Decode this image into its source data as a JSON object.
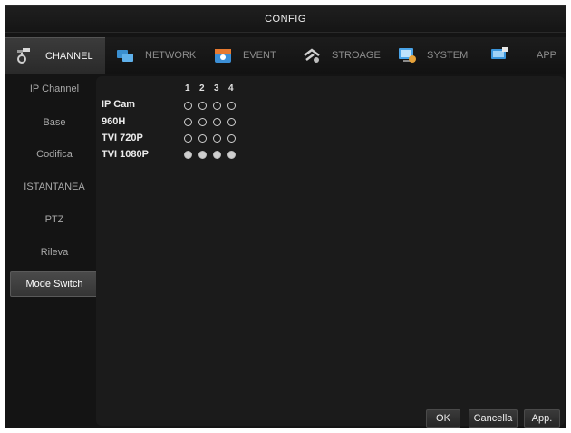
{
  "window": {
    "title": "CONFIG"
  },
  "tabs": [
    {
      "label": "CHANNEL",
      "icon": "channel-icon",
      "active": true
    },
    {
      "label": "NETWORK",
      "icon": "network-icon",
      "active": false
    },
    {
      "label": "EVENT",
      "icon": "event-icon",
      "active": false
    },
    {
      "label": "STROAGE",
      "icon": "storage-icon",
      "active": false
    },
    {
      "label": "SYSTEM",
      "icon": "system-icon",
      "active": false
    },
    {
      "label": "APP",
      "icon": "app-icon",
      "active": false
    }
  ],
  "sidebar": {
    "items": [
      {
        "label": "IP Channel",
        "active": false
      },
      {
        "label": "Base",
        "active": false
      },
      {
        "label": "Codifica",
        "active": false
      },
      {
        "label": "ISTANTANEA",
        "active": false
      },
      {
        "label": "PTZ",
        "active": false
      },
      {
        "label": "Rileva",
        "active": false
      },
      {
        "label": "Mode Switch",
        "active": true
      }
    ]
  },
  "mode_switch": {
    "channels": [
      "1",
      "2",
      "3",
      "4"
    ],
    "modes": [
      {
        "label": "IP Cam",
        "selected": [
          false,
          false,
          false,
          false
        ]
      },
      {
        "label": "960H",
        "selected": [
          false,
          false,
          false,
          false
        ]
      },
      {
        "label": "TVI 720P",
        "selected": [
          false,
          false,
          false,
          false
        ]
      },
      {
        "label": "TVI 1080P",
        "selected": [
          true,
          true,
          true,
          true
        ]
      }
    ]
  },
  "buttons": {
    "ok": "OK",
    "cancel": "Cancella",
    "apply": "App."
  }
}
